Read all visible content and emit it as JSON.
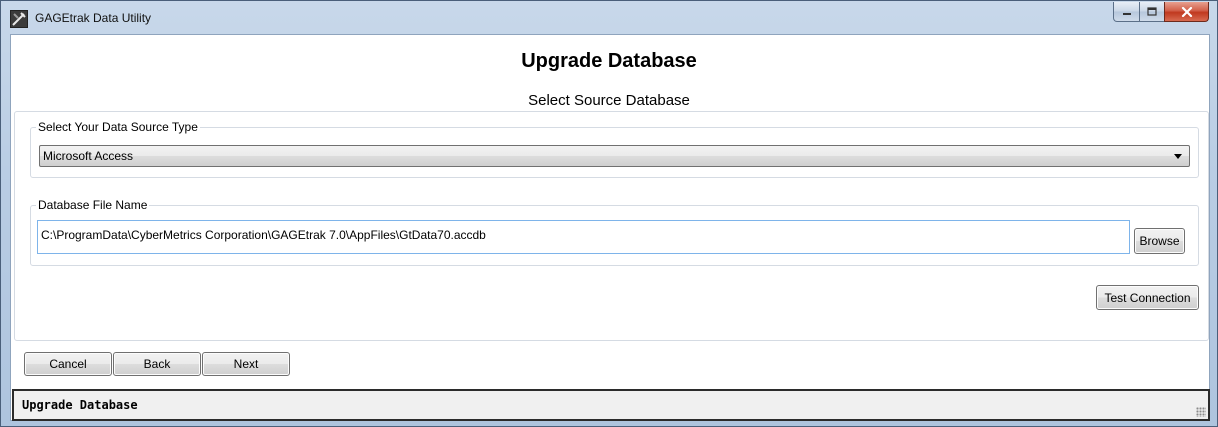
{
  "window": {
    "title": "GAGEtrak Data Utility",
    "icon": "app-tool-icon",
    "controls": [
      "minimize-icon",
      "maximize-icon",
      "close-icon"
    ]
  },
  "page": {
    "title": "Upgrade Database",
    "subtitle": "Select Source Database"
  },
  "source_type": {
    "legend": "Select Your Data Source Type",
    "selected": "Microsoft Access"
  },
  "database_file": {
    "legend": "Database File Name",
    "value": "C:\\ProgramData\\CyberMetrics Corporation\\GAGEtrak 7.0\\AppFiles\\GtData70.accdb",
    "browse_label": "Browse"
  },
  "test_connection_label": "Test Connection",
  "nav": {
    "cancel_label": "Cancel",
    "back_label": "Back",
    "next_label": "Next"
  },
  "status": {
    "text": "Upgrade Database"
  },
  "colors": {
    "input_border_focus": "#7eb4ea",
    "close_button": "#c0391f",
    "frame": "#b9cde4"
  }
}
